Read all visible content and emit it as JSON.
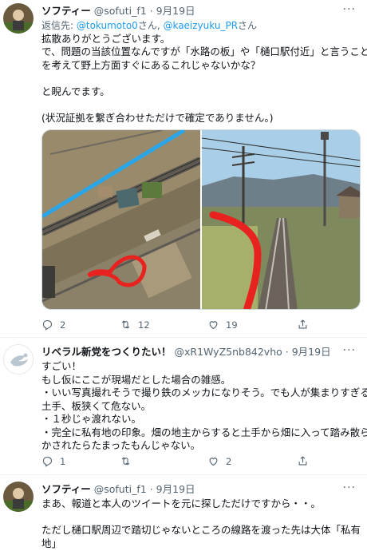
{
  "tweet1": {
    "name": "ソフティー",
    "handle": "@sofuti_f1",
    "sep": "·",
    "date": "9月19日",
    "reply_prefix": "返信先: ",
    "reply_user1": "@tokumoto0",
    "reply_mid": "さん, ",
    "reply_user2": "@kaeizyuku_PR",
    "reply_suffix": "さん",
    "lines": [
      "拡散ありがとうございます。",
      "で、問題の当該位置なんですが「水路の板」や「樋口駅付近」と言うこと",
      "を考えて野上方面すぐにあるこれじゃないかな？",
      "",
      "と睨んでます。",
      "",
      "(状況証拠を繋ぎ合わせただけで確定でありません。)"
    ],
    "replies": "2",
    "retweets": "12",
    "likes": "19"
  },
  "tweet2": {
    "name": "リベラル新党をつくりたい！",
    "handle": "@xR1WyZ5nb842vho",
    "sep": "·",
    "date": "9月19日",
    "lines": [
      "すごい！",
      "もし仮にここが現場だとした場合の雑感。",
      "・いい写真撮れそうで撮り鉄のメッカになりそう。でも人が集まりすぎると",
      "土手、板狭くて危ない。",
      "・１秒じゃ渡れない。",
      "・完全に私有地の印象。畑の地主からすると土手から畑に入って踏み散ら",
      "かされたらたまったもんじゃない。"
    ],
    "replies": "1",
    "retweets": "",
    "likes": "2"
  },
  "tweet3": {
    "name": "ソフティー",
    "handle": "@sofuti_f1",
    "sep": "·",
    "date": "9月19日",
    "lines": [
      "まあ、報道と本人のツイートを元に探しただけですから・・。",
      "",
      "ただし樋口駅周辺で踏切じゃないところの線路を渡った先は大体「私有",
      "地」"
    ]
  },
  "icons": {
    "more": "more-icon",
    "reply": "reply-icon",
    "retweet": "retweet-icon",
    "like": "heart-icon",
    "share": "share-icon"
  },
  "colors": {
    "link": "#1d9bf0",
    "secondary_text": "#536471",
    "annotation_red": "#e8231f",
    "annotation_blue": "#2aa6e8"
  }
}
